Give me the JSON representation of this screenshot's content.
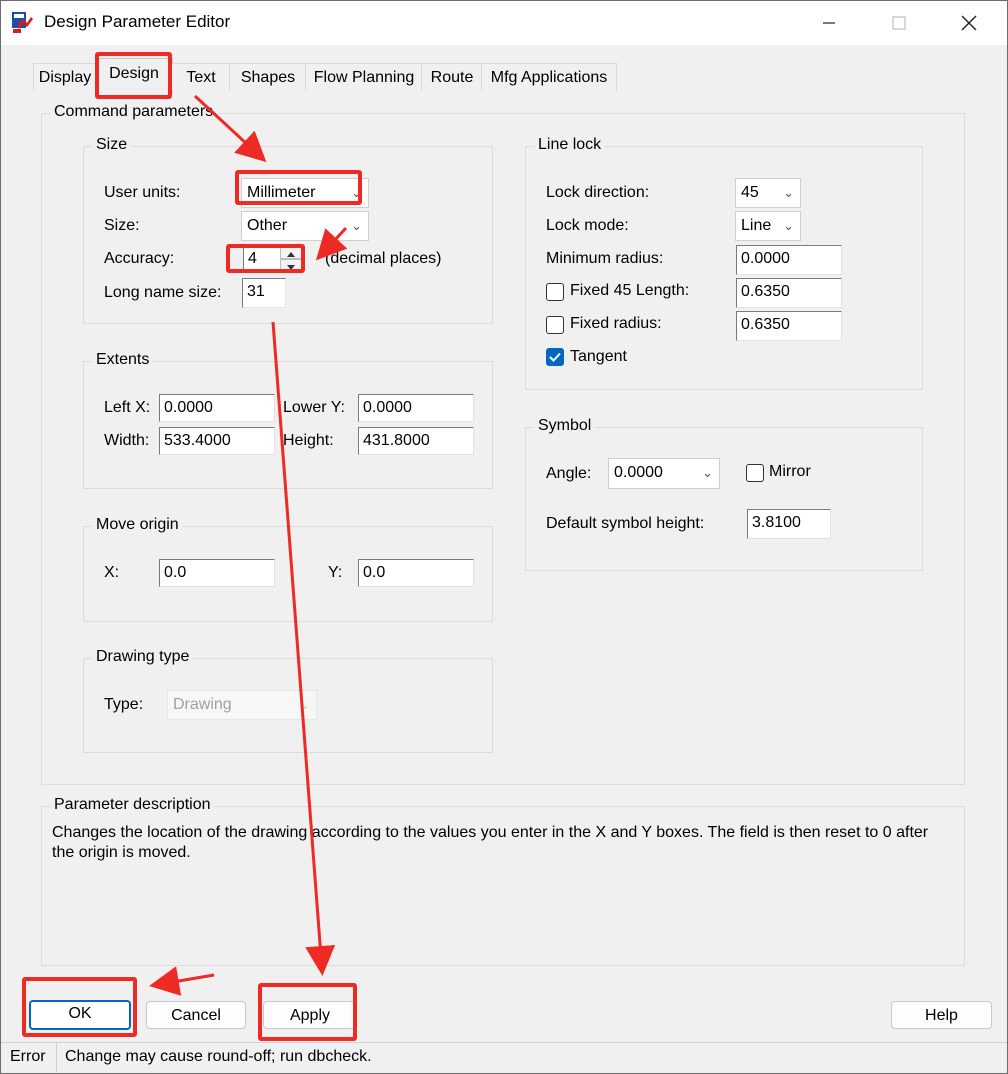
{
  "window": {
    "title": "Design Parameter Editor"
  },
  "tabs": [
    {
      "label": "Display"
    },
    {
      "label": "Design"
    },
    {
      "label": "Text"
    },
    {
      "label": "Shapes"
    },
    {
      "label": "Flow Planning"
    },
    {
      "label": "Route"
    },
    {
      "label": "Mfg Applications"
    }
  ],
  "command_parameters": {
    "title": "Command parameters"
  },
  "size_group": {
    "title": "Size",
    "user_units_label": "User units:",
    "user_units_value": "Millimeter",
    "size_label": "Size:",
    "size_value": "Other",
    "accuracy_label": "Accuracy:",
    "accuracy_value": "4",
    "accuracy_suffix": "(decimal places)",
    "long_name_label": "Long name size:",
    "long_name_value": "31"
  },
  "extents_group": {
    "title": "Extents",
    "left_x_label": "Left X:",
    "left_x_value": "0.0000",
    "lower_y_label": "Lower Y:",
    "lower_y_value": "0.0000",
    "width_label": "Width:",
    "width_value": "533.4000",
    "height_label": "Height:",
    "height_value": "431.8000"
  },
  "move_origin_group": {
    "title": "Move origin",
    "x_label": "X:",
    "x_value": "0.0",
    "y_label": "Y:",
    "y_value": "0.0"
  },
  "drawing_type_group": {
    "title": "Drawing type",
    "type_label": "Type:",
    "type_value": "Drawing"
  },
  "line_lock_group": {
    "title": "Line lock",
    "lock_direction_label": "Lock direction:",
    "lock_direction_value": "45",
    "lock_mode_label": "Lock mode:",
    "lock_mode_value": "Line",
    "min_radius_label": "Minimum radius:",
    "min_radius_value": "0.0000",
    "fixed45_label": "Fixed 45 Length:",
    "fixed45_value": "0.6350",
    "fixed45_checked": false,
    "fixed_radius_label": "Fixed radius:",
    "fixed_radius_value": "0.6350",
    "fixed_radius_checked": false,
    "tangent_label": "Tangent",
    "tangent_checked": true
  },
  "symbol_group": {
    "title": "Symbol",
    "angle_label": "Angle:",
    "angle_value": "0.0000",
    "mirror_label": "Mirror",
    "mirror_checked": false,
    "default_height_label": "Default symbol height:",
    "default_height_value": "3.8100"
  },
  "parameter_description": {
    "title": "Parameter description",
    "text": "Changes the location of the drawing according to the values you enter in the X and Y boxes. The field is then reset to 0 after the origin is moved."
  },
  "buttons": {
    "ok": "OK",
    "cancel": "Cancel",
    "apply": "Apply",
    "help": "Help"
  },
  "status_bar": {
    "severity": "Error",
    "message": "Change may cause round-off; run dbcheck."
  },
  "icons": {
    "close": "close-icon",
    "minimize": "minimize-icon",
    "maximize": "maximize-icon",
    "dropdown": "chevron-down-icon",
    "spin_up": "spin-up-icon",
    "spin_down": "spin-down-icon",
    "check": "check-icon"
  },
  "colors": {
    "annotation": "#ee2a24",
    "checkbox_accent": "#0067c0",
    "default_button_border": "#0067c0"
  }
}
